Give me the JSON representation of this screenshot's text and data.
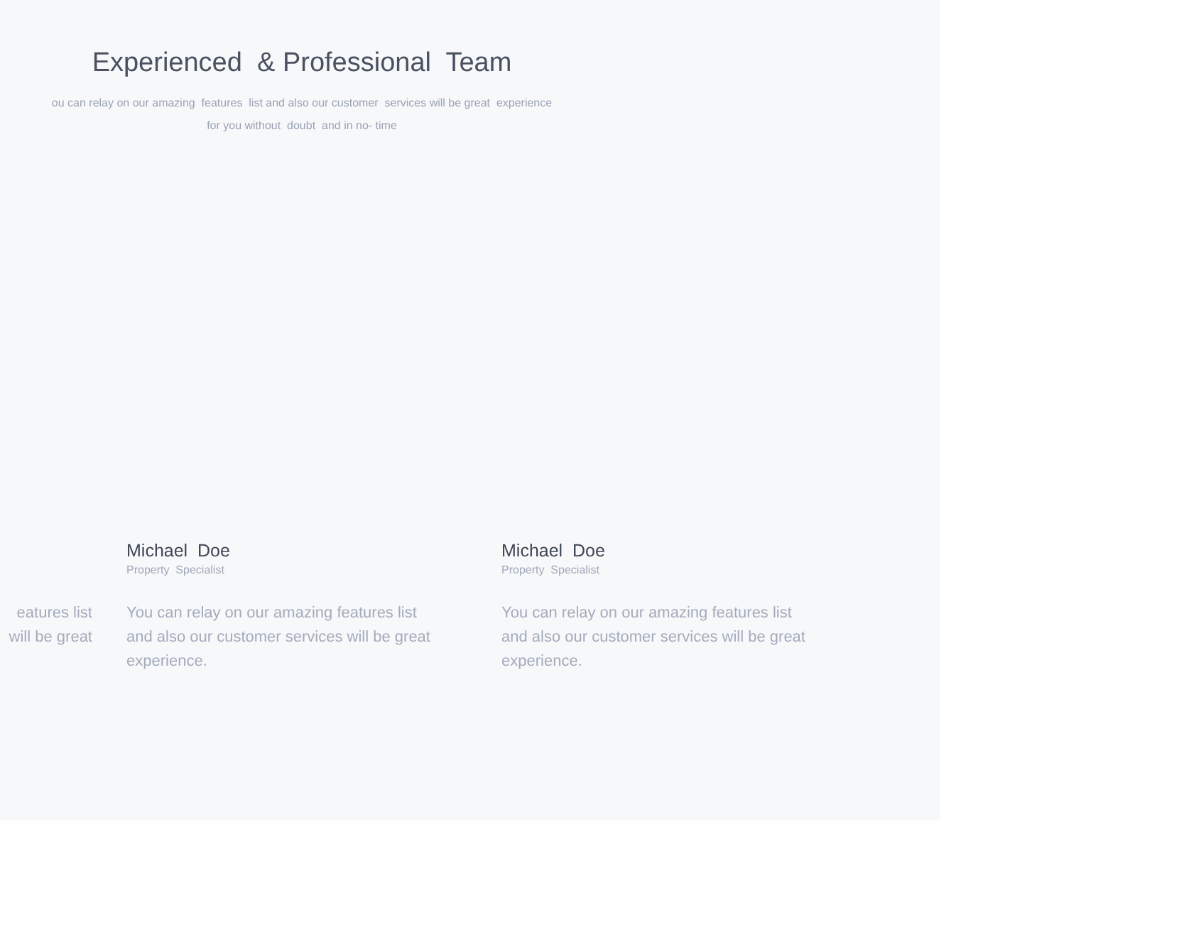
{
  "section": {
    "title": "Experienced  & Professional  Team",
    "subtitle_lines": [
      "ou can relay on our amazing  features  list and also our customer  services will be great  experience",
      "for you without  doubt  and in no- time"
    ]
  },
  "team_cards": [
    {
      "body": "eatures  list\nwill be great"
    },
    {
      "name": "Michael  Doe",
      "role": "Property  Specialist",
      "body": "You can relay on our amazing  features  list\nand also our customer  services will be great\nexperience."
    },
    {
      "name": "Michael  Doe",
      "role": "Property  Specialist",
      "body": "You can relay on our amazing  features  list\nand also our customer  services will be great\nexperience."
    }
  ]
}
